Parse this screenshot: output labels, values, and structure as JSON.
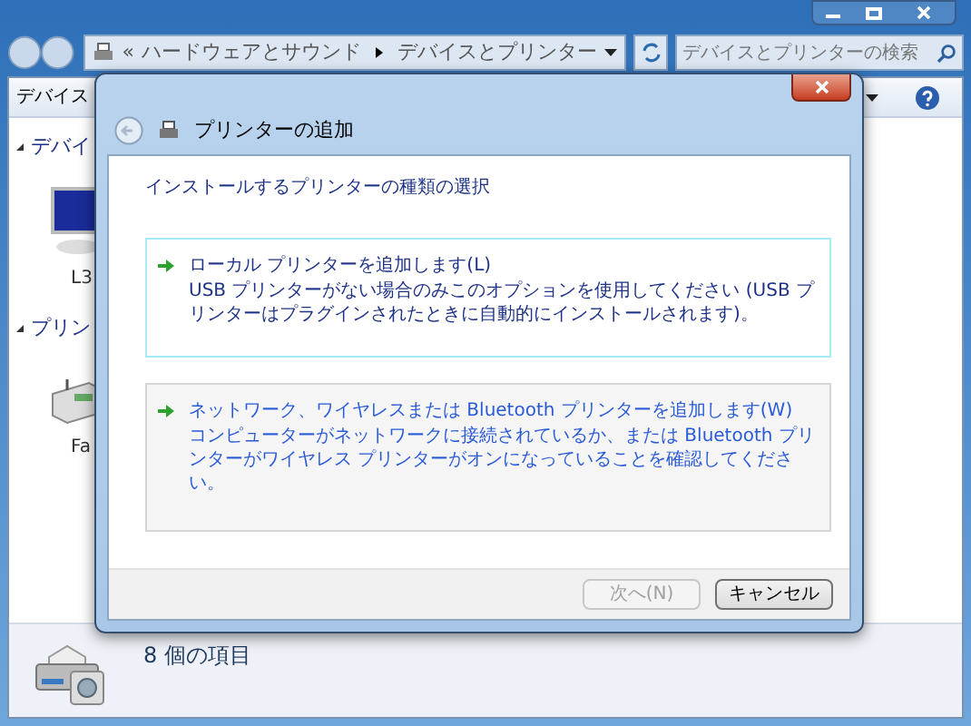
{
  "address_bar": {
    "overflow": "«",
    "crumbs": [
      "ハードウェアとサウンド",
      "デバイスとプリンター"
    ]
  },
  "search": {
    "placeholder": "デバイスとプリンターの検索"
  },
  "toolbar": {
    "items": [
      "デバイス"
    ]
  },
  "groups": [
    {
      "title": "デバイ",
      "expanded": true,
      "items": [
        {
          "label": "L3",
          "kind": "monitor"
        }
      ]
    },
    {
      "title": "プリン",
      "expanded": true,
      "items": [
        {
          "label": "Fa",
          "kind": "fax"
        }
      ]
    }
  ],
  "details": {
    "count": "8 個の項目"
  },
  "dialog": {
    "title": "プリンターの追加",
    "heading": "インストールするプリンターの種類の選択",
    "options": [
      {
        "title": "ローカル プリンターを追加します(L)",
        "description": "USB プリンターがない場合のみこのオプションを使用してください (USB プリンターはプラグインされたときに自動的にインストールされます)。",
        "selected": true
      },
      {
        "title": "ネットワーク、ワイヤレスまたは Bluetooth プリンターを追加します(W)",
        "description": "コンピューターがネットワークに接続されているか、または Bluetooth プリンターがワイヤレス プリンターがオンになっていることを確認してください。",
        "selected": false
      }
    ],
    "buttons": [
      {
        "label": "次へ(N)",
        "disabled": true
      },
      {
        "label": "キャンセル",
        "disabled": false
      }
    ]
  }
}
